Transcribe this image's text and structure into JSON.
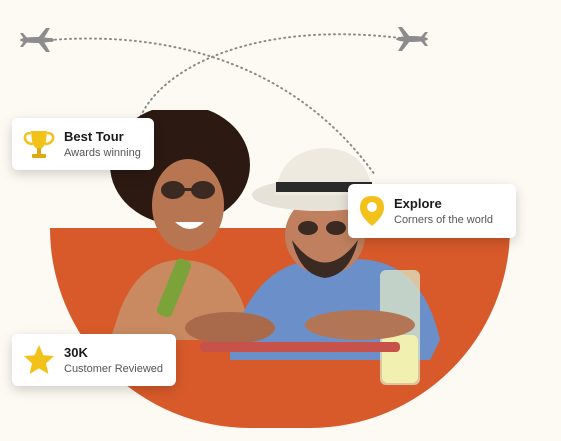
{
  "cards": {
    "best_tour": {
      "title": "Best Tour",
      "subtitle": "Awards winning",
      "icon": "trophy-icon"
    },
    "explore": {
      "title": "Explore",
      "subtitle": "Corners of the world",
      "icon": "map-pin-icon"
    },
    "reviews": {
      "title": "30K",
      "subtitle": "Customer Reviewed",
      "icon": "star-icon"
    }
  },
  "colors": {
    "accent": "#d85a2a",
    "icon_gold": "#f2c11a",
    "background": "#fdfaf3",
    "plane": "#8c8c8c"
  }
}
